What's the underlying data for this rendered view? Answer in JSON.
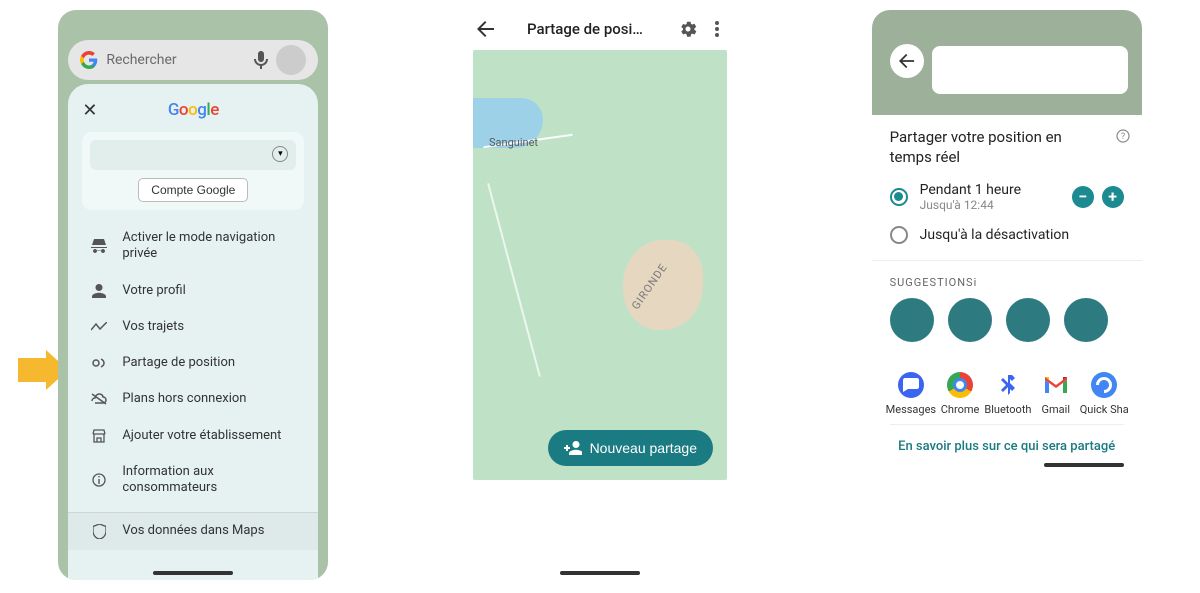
{
  "screen1": {
    "search_placeholder": "Rechercher",
    "google_account_button": "Compte Google",
    "menu": {
      "incognito": "Activer le mode navigation privée",
      "profile": "Votre profil",
      "trips": "Vos trajets",
      "location_sharing": "Partage de position",
      "offline": "Plans hors connexion",
      "add_business": "Ajouter votre établissement",
      "consumer_info": "Information aux consommateurs",
      "your_data": "Vos données dans Maps"
    }
  },
  "screen2": {
    "title": "Partage de posi…",
    "map": {
      "place1": "Sanguinet",
      "region": "GIRONDE"
    },
    "new_share_button": "Nouveau partage"
  },
  "screen3": {
    "title": "Partager votre position en temps réel",
    "options": {
      "duration_label": "Pendant 1 heure",
      "duration_sub": "Jusqu'à 12:44",
      "until_off": "Jusqu'à la désactivation"
    },
    "suggestions_label": "SUGGESTIONS",
    "apps": {
      "messages": "Messages",
      "chrome": "Chrome",
      "bluetooth": "Bluetooth",
      "gmail": "Gmail",
      "quick": "Quick Share"
    },
    "learn_more": "En savoir plus sur ce qui sera partagé"
  }
}
